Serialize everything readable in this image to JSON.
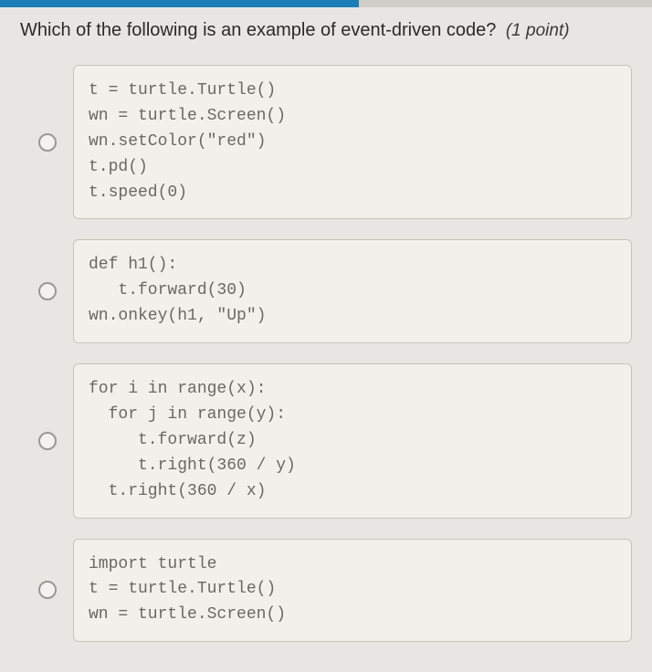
{
  "question": {
    "text": "Which of the following is an example of event-driven code?",
    "points_label": "(1 point)"
  },
  "options": [
    {
      "code": "t = turtle.Turtle()\nwn = turtle.Screen()\nwn.setColor(\"red\")\nt.pd()\nt.speed(0)"
    },
    {
      "code": "def h1():\n   t.forward(30)\nwn.onkey(h1, \"Up\")"
    },
    {
      "code": "for i in range(x):\n  for j in range(y):\n     t.forward(z)\n     t.right(360 / y)\n  t.right(360 / x)"
    },
    {
      "code": "import turtle\nt = turtle.Turtle()\nwn = turtle.Screen()"
    }
  ]
}
